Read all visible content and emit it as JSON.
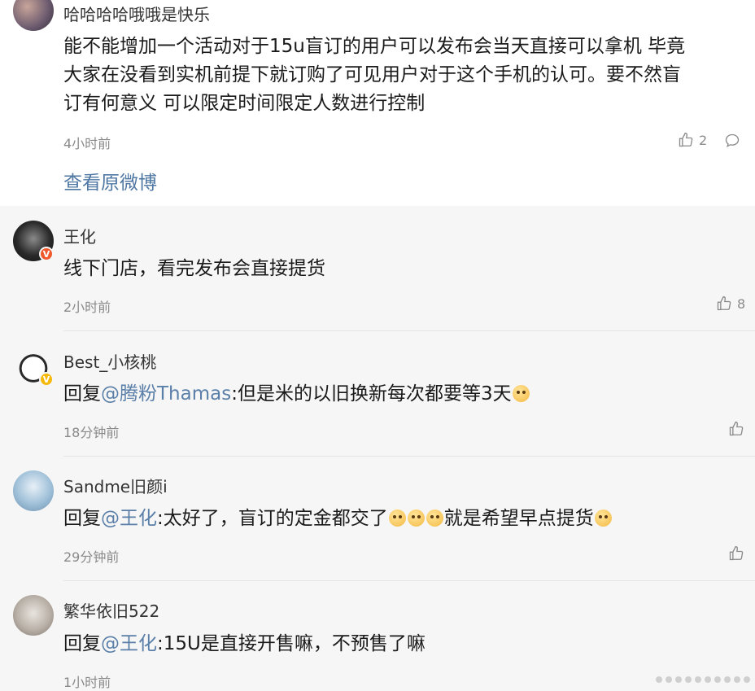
{
  "post": {
    "user": "哈哈哈哈哦哦是快乐",
    "lines": [
      "能不能增加一个活动对于15u盲订的用户可以发布会当天直接可以拿机 毕竟",
      "大家在没看到实机前提下就订购了可见用户对于这个手机的认可。要不然盲",
      "订有何意义 可以限定时间限定人数进行控制"
    ],
    "time": "4小时前",
    "likes": "2",
    "view_original": "查看原微博"
  },
  "replies": [
    {
      "user": "王化",
      "badge": "V",
      "prefix": "",
      "mention": "",
      "text": "线下门店，看完发布会直接提货",
      "time": "2小时前",
      "likes": "8"
    },
    {
      "user": "Best_小核桃",
      "badge": "V",
      "prefix": "回复",
      "mention": "@腾粉Thamas",
      "text": ":但是米的以旧换新每次都要等3天",
      "time": "18分钟前",
      "likes": ""
    },
    {
      "user": "Sandme旧颜i",
      "badge": "",
      "prefix": "回复",
      "mention": "@王化",
      "text": ":太好了，盲订的定金都交了",
      "text2": "就是希望早点提货",
      "time": "29分钟前",
      "likes": ""
    },
    {
      "user": "繁华依旧522",
      "badge": "",
      "prefix": "回复",
      "mention": "@王化",
      "text": ":15U是直接开售嘛，不预售了嘛",
      "time": "1小时前",
      "likes": ""
    }
  ],
  "colors": {
    "mention": "#5a7fa8",
    "link": "#4f77a3",
    "badge_red": "#f0582d",
    "badge_gold": "#f5b90a"
  },
  "icons": [
    "thumbs-up-icon",
    "comment-icon",
    "emoji-face-icon"
  ]
}
